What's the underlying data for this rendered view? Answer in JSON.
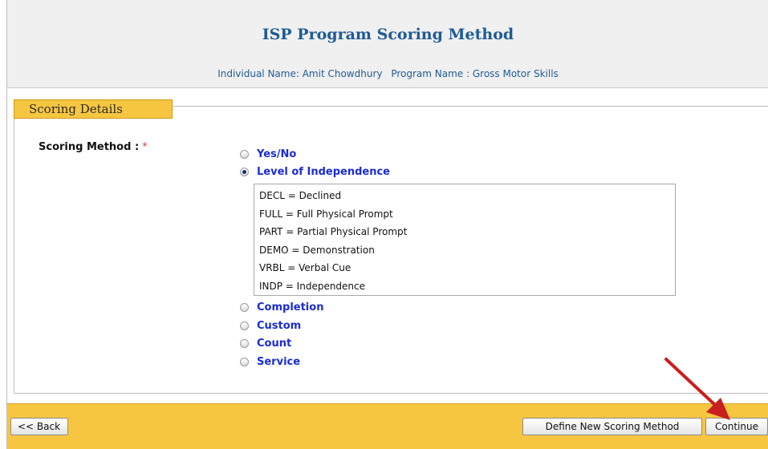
{
  "header": {
    "title": "ISP Program Scoring Method",
    "individual_label": "Individual Name:",
    "individual_name": "Amit Chowdhury",
    "program_label": "Program Name :",
    "program_name": "Gross Motor Skills"
  },
  "section": {
    "legend": "Scoring Details"
  },
  "field": {
    "label": "Scoring Method :",
    "required_mark": "*"
  },
  "options": [
    {
      "label": "Yes/No",
      "checked": false
    },
    {
      "label": "Level of Independence",
      "checked": true
    },
    {
      "label": "Completion",
      "checked": false
    },
    {
      "label": "Custom",
      "checked": false
    },
    {
      "label": "Count",
      "checked": false
    },
    {
      "label": "Service",
      "checked": false
    }
  ],
  "levels": [
    "DECL = Declined",
    "FULL = Full Physical Prompt",
    "PART = Partial Physical Prompt",
    "DEMO = Demonstration",
    "VRBL = Verbal Cue",
    "INDP = Independence"
  ],
  "footer": {
    "back_label": "<< Back",
    "define_label": "Define New Scoring Method",
    "continue_label": "Continue"
  },
  "colors": {
    "title": "#1f5b93",
    "option_label": "#1b2cd4",
    "footer_bg": "#f7c641",
    "required": "#e23a3a",
    "annotation_arrow": "#c8201e"
  }
}
